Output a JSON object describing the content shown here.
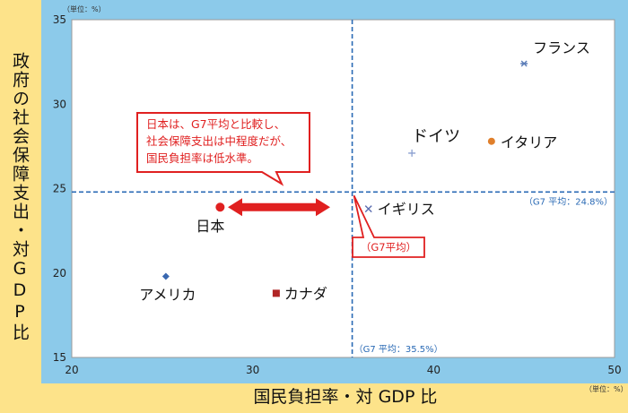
{
  "chart_data": {
    "type": "scatter",
    "xlabel": "国民負担率・対 GDP 比",
    "ylabel": "政府の社会保障支出・対GDP比",
    "unit_y": "（単位：%）",
    "unit_x": "（単位：%）",
    "xlim": [
      20,
      50
    ],
    "ylim": [
      15,
      35
    ],
    "x_ticks": [
      20,
      30,
      40,
      50
    ],
    "y_ticks": [
      15,
      20,
      25,
      30,
      35
    ],
    "grid": false,
    "points": [
      {
        "name": "フランス",
        "x": 45.0,
        "y": 32.4,
        "marker": "asterisk",
        "color": "#5b7db8"
      },
      {
        "name": "ドイツ",
        "x": 38.8,
        "y": 27.1,
        "marker": "plus",
        "color": "#8a9fd0"
      },
      {
        "name": "イタリア",
        "x": 43.2,
        "y": 27.8,
        "marker": "circle",
        "color": "#e07f2b"
      },
      {
        "name": "イギリス",
        "x": 36.4,
        "y": 23.8,
        "marker": "x",
        "color": "#5b6db0"
      },
      {
        "name": "日本",
        "x": 28.2,
        "y": 23.9,
        "marker": "circle",
        "color": "#e02020"
      },
      {
        "name": "アメリカ",
        "x": 25.2,
        "y": 19.8,
        "marker": "diamond",
        "color": "#3a68b0"
      },
      {
        "name": "カナダ",
        "x": 31.3,
        "y": 18.8,
        "marker": "square",
        "color": "#b02525"
      }
    ],
    "reference_lines": [
      {
        "axis": "y",
        "value": 24.8,
        "label": "（G7 平均：24.8%）"
      },
      {
        "axis": "x",
        "value": 35.5,
        "label": "（G7 平均：35.5%）"
      }
    ],
    "annotations": {
      "callout_lines": [
        "日本は、G7平均と比較し、",
        "社会保障支出は中程度だが、",
        "国民負担率は低水準。"
      ],
      "g7_tag": "（G7平均）"
    },
    "colors": {
      "plot_frame": "#8ccaea",
      "outer": "#fde38a",
      "ref_line": "#2a6ab5",
      "callout": "#e02020"
    }
  }
}
